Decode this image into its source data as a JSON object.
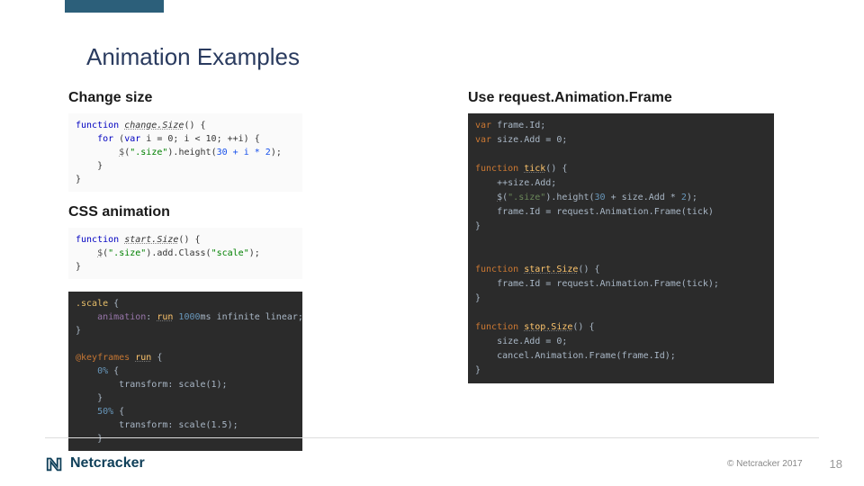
{
  "title": "Animation Examples",
  "left": {
    "heading1": "Change size",
    "heading2": "CSS animation"
  },
  "right": {
    "heading": "Use request.Animation.Frame"
  },
  "code": {
    "changeSize": {
      "fn": "change.Size",
      "for_kw": "for",
      "var_kw": "var",
      "loop_init": "i = 0; i < 10; ++i",
      "sel": "\".size\"",
      "method": "height",
      "expr": "30 + i * 2"
    },
    "cssStart": {
      "fn": "start.Size",
      "sel": "\".size\"",
      "method": "add.Class",
      "arg": "\"scale\""
    },
    "cssRule": {
      "selector": ".scale",
      "prop": "animation",
      "val": "run 1000ms infinite linear",
      "keyframes_kw": "@keyframes",
      "name": "run",
      "stop1": "0%",
      "tr1": "transform: scale(1);",
      "stop2": "50%",
      "tr2": "transform: scale(1.5);"
    },
    "raf": {
      "var_kw": "var",
      "decl1": "frame.Id;",
      "decl2": "size.Add = 0;",
      "fn_tick": "tick",
      "inc": "++size.Add;",
      "sel": "\".size\"",
      "height_call": "height",
      "height_arg": "30 + size.Add * 2",
      "assign_tick": "frame.Id = request.Animation.Frame(tick)",
      "fn_start": "start.Size",
      "start_body": "frame.Id = request.Animation.Frame(tick);",
      "fn_stop": "stop.Size",
      "stop_l1": "size.Add = 0;",
      "stop_l2": "cancel.Animation.Frame(frame.Id);"
    }
  },
  "footer": {
    "brand": "Netcracker",
    "copyright": "© Netcracker 2017",
    "page": "18"
  }
}
